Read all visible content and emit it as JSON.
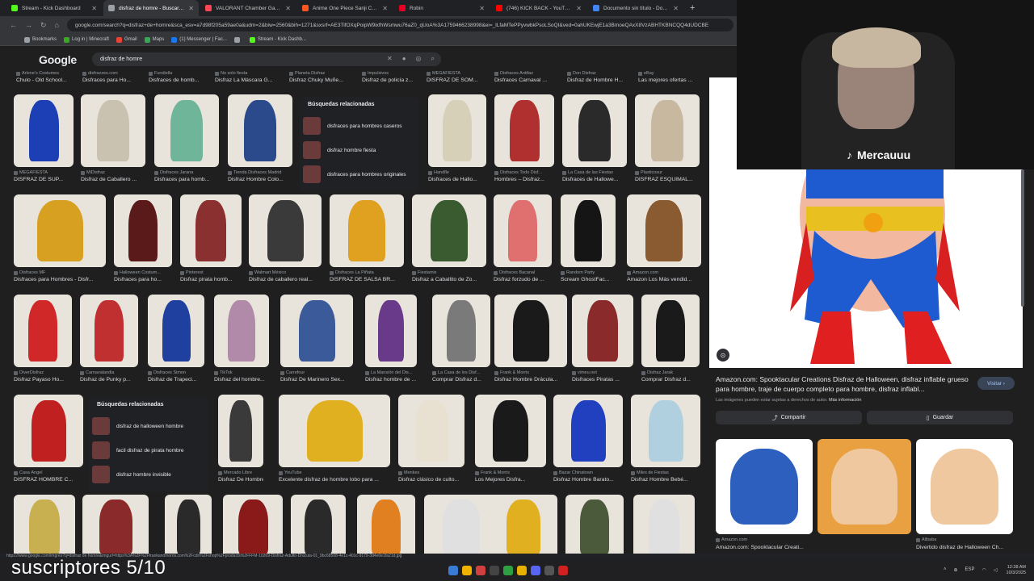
{
  "tabs": [
    {
      "label": "Stream - Kick Dashboard",
      "color": "#53fc18"
    },
    {
      "label": "disfraz de homre - Buscar con G",
      "color": "#9aa0a6"
    },
    {
      "label": "VALORANT Chamber Game Co",
      "color": "#ff4655"
    },
    {
      "label": "Anime One Piece Sanji Cosplay",
      "color": "#ff5722"
    },
    {
      "label": "Robin",
      "color": "#e60023"
    },
    {
      "label": "(746) KICK BACK - YouTube",
      "color": "#ff0000"
    },
    {
      "label": "Documento sin título - Docum",
      "color": "#4285f4"
    }
  ],
  "address": {
    "url": "google.com/search?q=disfraz+de+homre&sca_esv=a7d98f205a59ae0a&udm=2&biw=2560&bih=1271&sxsrf=AE3TifOXqPoipW9ixfhWsmwu76aZ0_qUoA%3A1759466238998&ei=_lLfaMTePPyvwbkPsoLSoQI&ved=0ahUKEwjE1a3BmoeQAxX8VzABHTKBNCQQ4dUDCBE"
  },
  "bookmarks": [
    "Bookmarks",
    "Log in | Minecraft",
    "Gmail",
    "Maps",
    "(1) Messenger | Fac...",
    "",
    "Stream - Kick Dashb..."
  ],
  "google": {
    "logo": "Google",
    "query": "disfraz de homre"
  },
  "top_row": [
    {
      "src": "Arlene's Costumes",
      "cap": "Chulo - Old School..."
    },
    {
      "src": "disfrazzes.com",
      "cap": "Disfraces para Ho..."
    },
    {
      "src": "Fundiella",
      "cap": "Disfraces de homb..."
    },
    {
      "src": "No solo fiesta",
      "cap": "Disfraz La Máscara G..."
    },
    {
      "src": "Planeta Disfraz",
      "cap": "Disfraz Chuky Muñe..."
    },
    {
      "src": "Impulsivos",
      "cap": "Disfraz de policía z..."
    },
    {
      "src": "MEGAFIESTA",
      "cap": "DISFRAZ DE SOM..."
    },
    {
      "src": "Disfraces Antifaz",
      "cap": "Disfraces Carnaval ..."
    },
    {
      "src": "Don Disfraz",
      "cap": "Disfraz de Hombre H..."
    },
    {
      "src": "eBay",
      "cap": "Las mejores ofertas ..."
    }
  ],
  "row1": [
    {
      "src": "MEGAFIESTA",
      "cap": "DISFRAZ DE SUP...",
      "color": "#1d3fb5"
    },
    {
      "src": "MiDisfraz",
      "cap": "Disfraz de Caballero ...",
      "color": "#c9c2b0"
    },
    {
      "src": "Disfraces Jarana",
      "cap": "Disfraces para homb...",
      "color": "#6fb59a"
    },
    {
      "src": "Tienda Disfraces Madrid",
      "cap": "Disfraz Hombre Colo...",
      "color": "#2a4a8c"
    },
    {
      "src": "Handfle",
      "cap": "Disfraces de Hallo...",
      "color": "#d6d0b8"
    },
    {
      "src": "Disfraces Todo Disf...",
      "cap": "Hombres – Disfraz...",
      "color": "#b03030"
    },
    {
      "src": "La Casa de las Fiestas",
      "cap": "Disfraces de Hallowe...",
      "color": "#2a2a2a"
    },
    {
      "src": "Plasticosur",
      "cap": "DISFRAZ ESQUIMAL...",
      "color": "#c8b8a0"
    }
  ],
  "related1": {
    "title": "Búsquedas relacionadas",
    "items": [
      "disfraces para hombres caseros",
      "disfraz hombre fiesta",
      "disfraces para hombres originales"
    ]
  },
  "row2": [
    {
      "src": "Disfraces MF",
      "cap": "Disfraces para Hombres - Disfr...",
      "color": "#d8a020"
    },
    {
      "src": "Halloween Costum...",
      "cap": "Disfraces para ho...",
      "color": "#5a1a1a"
    },
    {
      "src": "Pinterest",
      "cap": "Disfraz pirata homb...",
      "color": "#8a3030"
    },
    {
      "src": "Walmart México",
      "cap": "Disfraz de caballero real...",
      "color": "#3a3a3a"
    },
    {
      "src": "Disfraces La Piñata",
      "cap": "DISFRAZ DE SALSA BR...",
      "color": "#e0a020"
    },
    {
      "src": "Fiestamix",
      "cap": "Disfraz a Caballito de Zo...",
      "color": "#3a5a30"
    },
    {
      "src": "Disfraces Bacanal",
      "cap": "Disfraz forzudo de ...",
      "color": "#e07070"
    },
    {
      "src": "Random Party",
      "cap": "Scream GhostFac...",
      "color": "#151515"
    },
    {
      "src": "Amazon.com",
      "cap": "Amazon Los Más vendid...",
      "color": "#8a5a30"
    }
  ],
  "row3": [
    {
      "src": "DiverDisfraz",
      "cap": "Disfraz Payaso Ho...",
      "color": "#d02828"
    },
    {
      "src": "Carnavalandia",
      "cap": "Disfraz de Punky p...",
      "color": "#c03030"
    },
    {
      "src": "Disfraces Simon",
      "cap": "Disfraz de Trapeci...",
      "color": "#2040a0"
    },
    {
      "src": "TikTok",
      "cap": "Disfraz del hombre...",
      "color": "#b08aa8"
    },
    {
      "src": "Carrefour",
      "cap": "Disfraz De Marinero Sex...",
      "color": "#3a5a9a"
    },
    {
      "src": "La Mansión del Dis...",
      "cap": "Disfraz hombre de ...",
      "color": "#6a3a8a"
    },
    {
      "src": "La Casa de los Disf...",
      "cap": "Comprar Disfraz d...",
      "color": "#7a7a7a"
    },
    {
      "src": "Frank & Morris",
      "cap": "Disfraz Hombre Drácula...",
      "color": "#1a1a1a"
    },
    {
      "src": "vimeu.net",
      "cap": "Disfraces Piratas ...",
      "color": "#8a2a2a"
    },
    {
      "src": "Disfraz Jarak",
      "cap": "Comprar Disfraz d...",
      "color": "#1a1a1a"
    }
  ],
  "related2": {
    "title": "Búsquedas relacionadas",
    "items": [
      "disfraz de halloween hombre",
      "facil disfraz de pirata hombre",
      "disfraz hombre invisible"
    ]
  },
  "row4": [
    {
      "src": "Casa Ángel",
      "cap": "DISFRAZ HOMBRE C...",
      "color": "#c02020"
    },
    {
      "src": "Mercado Libre",
      "cap": "Disfraz De Hombre...",
      "color": "#3a3a3a"
    },
    {
      "src": "YouTube",
      "cap": "Excelente disfraz de hombre lobo para ...",
      "color": "#e0b020"
    },
    {
      "src": "Menkes",
      "cap": "Disfraz clásico de culto...",
      "color": "#e8e0d0"
    },
    {
      "src": "Frank & Morris",
      "cap": "Los Mejores Disfra...",
      "color": "#1a1a1a"
    },
    {
      "src": "Bazar Chinatown",
      "cap": "Disfraz Hombre Barato...",
      "color": "#2040c0"
    },
    {
      "src": "Miles de Fiestas",
      "cap": "Disfraz Hombre Bebé...",
      "color": "#b0d0e0"
    }
  ],
  "row5_colors": [
    "#c8b050",
    "#8a2a2a",
    "#2a2a2a",
    "#8a1a1a",
    "#2a2a2a",
    "#e08020",
    "#e0e0e0",
    "#e0b020",
    "#4a5a3a",
    "#e0e0e0"
  ],
  "side": {
    "title": "Amazon.com: Spooktacular Creations Disfraz de Halloween, disfraz inflable grueso para hombre, traje de cuerpo completo para hombre, disfraz inflabl...",
    "visit": "Visitar ›",
    "note": "Las imágenes pueden estar sujetas a derechos de autor.",
    "more": "Más información",
    "share": "Compartir",
    "save": "Guardar",
    "thumb1_src": "Amazon.com",
    "thumb1_cap": "Amazon.com: Spooktacular Creati...",
    "thumb3_src": "Alibaba",
    "thumb3_cap": "Divertido disfraz de Halloween Ch..."
  },
  "stream": {
    "tiktok": "Mercauuu",
    "subs": "suscriptores 5/10"
  },
  "statusbar": "https://www.google.com/imgres?q=disfraz de homre&imgurl=https%3A%2F%2Ffrankandmorris.com%2Fcdn%2Fshop%2Fproducts%2FFFM-10269-Disfraz-Adulto-Dracula-01_9bc68508-4e1c-401c-9179-3d4e0e1fa21d.jpg",
  "tray": {
    "lang": "ESP",
    "time": "12:38 AM",
    "date": "10/3/2025"
  }
}
